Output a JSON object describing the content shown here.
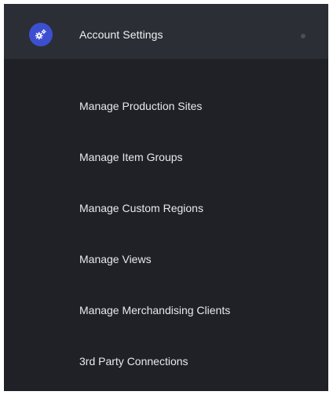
{
  "colors": {
    "panel_bg": "#1f2127",
    "header_bg": "#2b2e35",
    "accent": "#3d4fd1",
    "text": "#e9e9ec",
    "dot": "#4a4e57"
  },
  "header": {
    "icon": "gears-icon",
    "title": "Account Settings",
    "indicator": "dot"
  },
  "menu": {
    "items": [
      {
        "label": "Manage Production Sites"
      },
      {
        "label": "Manage Item Groups"
      },
      {
        "label": "Manage Custom Regions"
      },
      {
        "label": "Manage Views"
      },
      {
        "label": "Manage Merchandising Clients"
      },
      {
        "label": "3rd Party Connections"
      }
    ]
  }
}
